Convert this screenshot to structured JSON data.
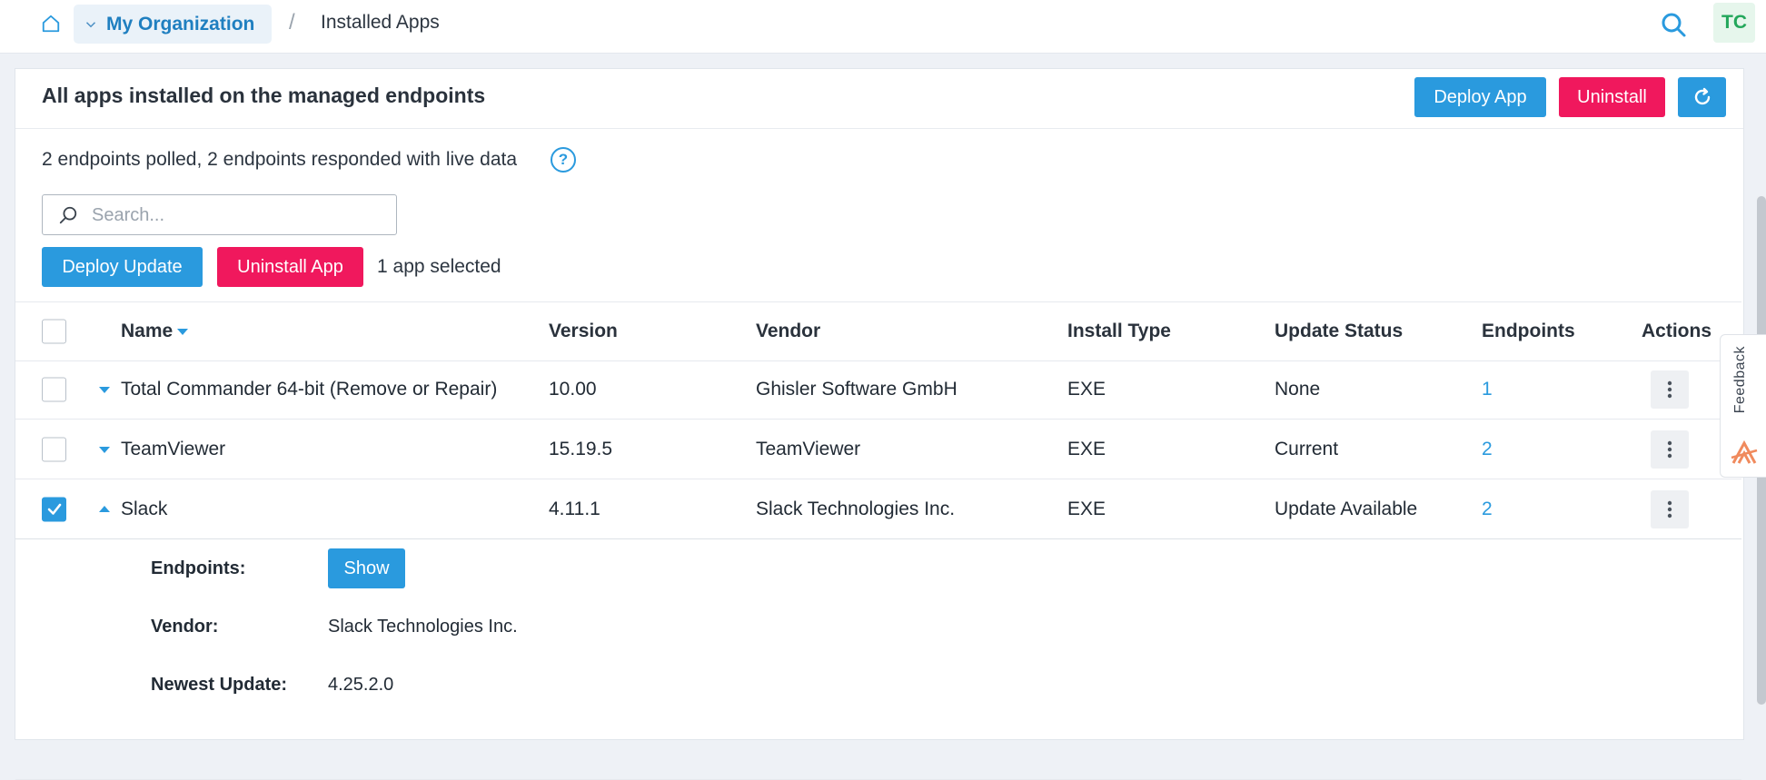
{
  "topbar": {
    "org_label": "My Organization",
    "separator": "/",
    "current_page": "Installed Apps",
    "avatar_initials": "TC"
  },
  "card": {
    "title": "All apps installed on the managed endpoints",
    "deploy_app_label": "Deploy App",
    "uninstall_label": "Uninstall",
    "refresh_icon": "refresh-icon"
  },
  "poll_status": "2 endpoints polled, 2 endpoints responded with live data",
  "help_glyph": "?",
  "search": {
    "placeholder": "Search...",
    "value": ""
  },
  "actions": {
    "deploy_update_label": "Deploy Update",
    "uninstall_app_label": "Uninstall App",
    "selected_text": "1 app selected"
  },
  "table": {
    "columns": {
      "name": "Name",
      "version": "Version",
      "vendor": "Vendor",
      "install_type": "Install Type",
      "update_status": "Update Status",
      "endpoints": "Endpoints",
      "actions": "Actions"
    },
    "rows": [
      {
        "name": "Total Commander 64-bit (Remove or Repair)",
        "version": "10.00",
        "vendor": "Ghisler Software GmbH",
        "install_type": "EXE",
        "update_status": "None",
        "endpoints": "1",
        "checked": false,
        "expanded": false
      },
      {
        "name": "TeamViewer",
        "version": "15.19.5",
        "vendor": "TeamViewer",
        "install_type": "EXE",
        "update_status": "Current",
        "endpoints": "2",
        "checked": false,
        "expanded": false
      },
      {
        "name": "Slack",
        "version": "4.11.1",
        "vendor": "Slack Technologies Inc.",
        "install_type": "EXE",
        "update_status": "Update Available",
        "endpoints": "2",
        "checked": true,
        "expanded": true
      }
    ]
  },
  "detail": {
    "endpoints_label": "Endpoints:",
    "show_label": "Show",
    "vendor_label": "Vendor:",
    "vendor_value": "Slack Technologies Inc.",
    "newest_update_label": "Newest Update:",
    "newest_update_value": "4.25.2.0"
  },
  "feedback": {
    "label": "Feedback"
  },
  "colors": {
    "accent_blue": "#2a9ade",
    "danger_pink": "#f0185d",
    "org_blue": "#1f7fc0",
    "avatar_green": "#23a75b"
  }
}
